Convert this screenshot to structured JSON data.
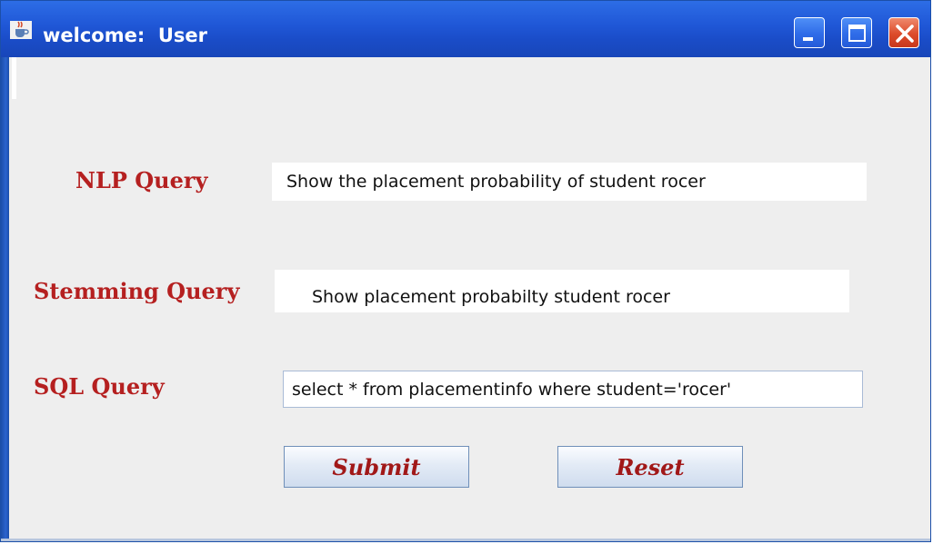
{
  "window": {
    "title": "welcome:  User",
    "icon": "java-cup-icon",
    "controls": {
      "minimize": "minimize-icon",
      "maximize": "maximize-icon",
      "close": "close-icon"
    }
  },
  "form": {
    "nlp": {
      "label": "NLP Query",
      "value": "Show the placement probability of student rocer"
    },
    "stemming": {
      "label": "Stemming Query",
      "value": "Show placement probabilty student rocer"
    },
    "sql": {
      "label": "SQL Query",
      "value": "select * from placementinfo where student='rocer'"
    }
  },
  "buttons": {
    "submit": "Submit",
    "reset": "Reset"
  },
  "colors": {
    "titlebar": "#1f56d6",
    "label": "#b52020",
    "button_text": "#a11818",
    "window_bg": "#eeeeee"
  }
}
